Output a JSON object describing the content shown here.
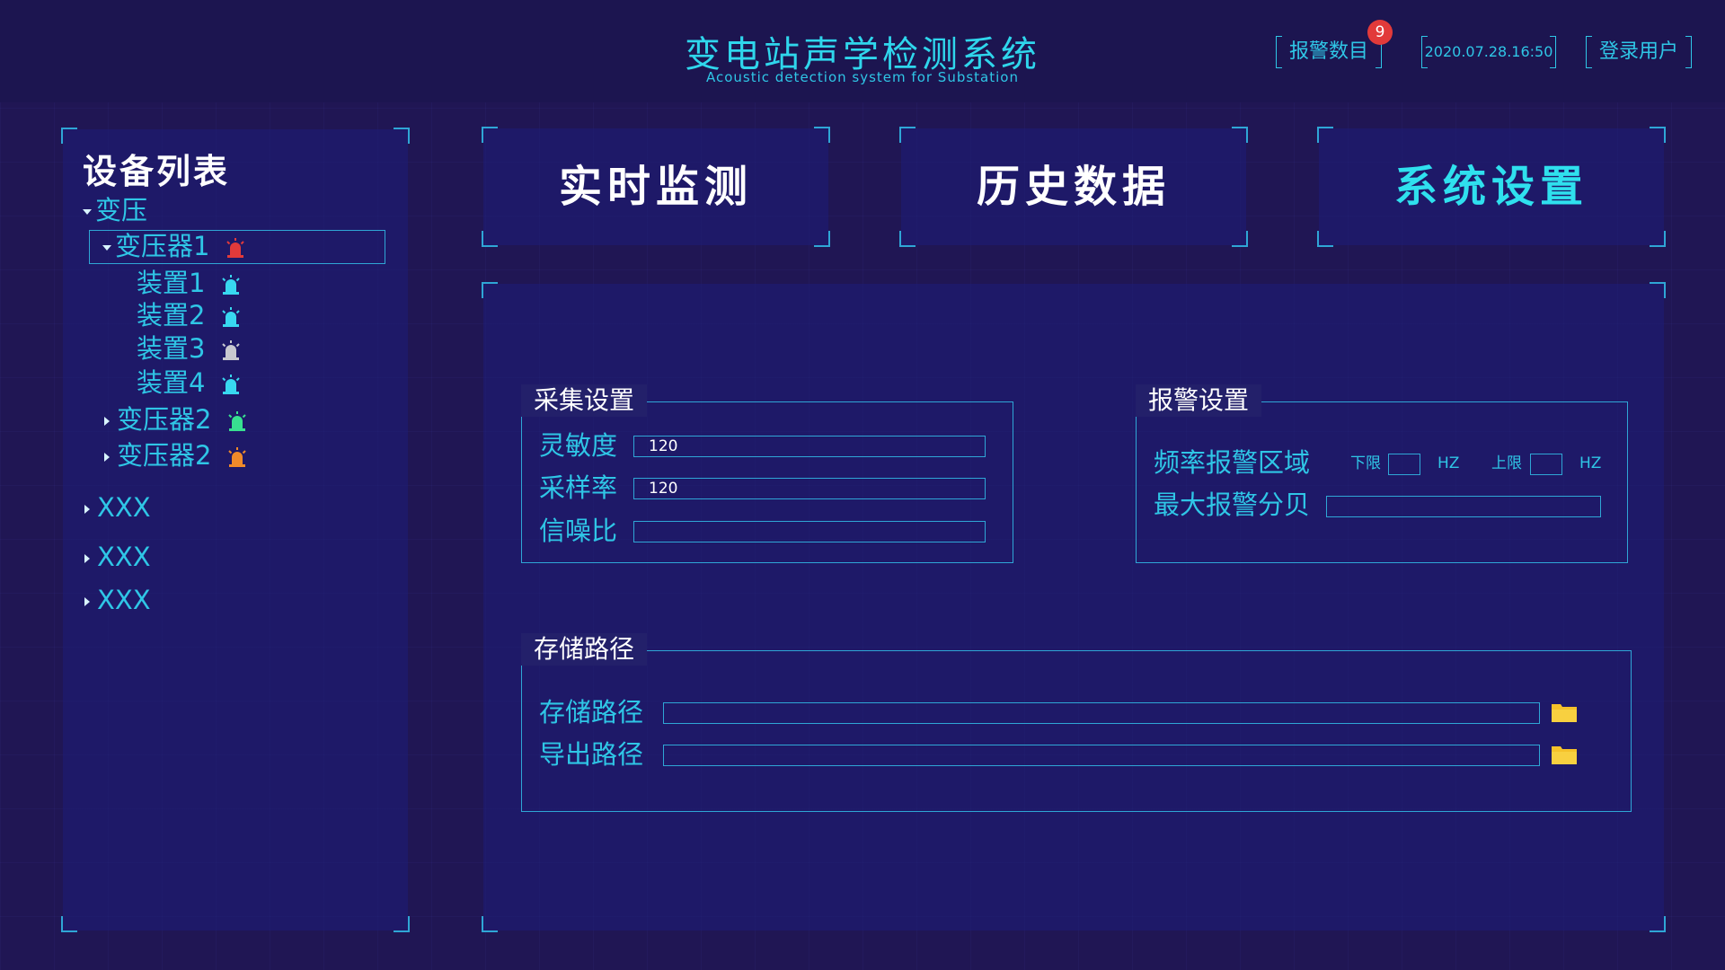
{
  "header": {
    "title_cn": "变电站声学检测系统",
    "title_en": "Acoustic detection system for Substation",
    "alarm_label": "报警数目",
    "alarm_count": "9",
    "datetime": "2020.07.28.16:50",
    "user_label": "登录用户"
  },
  "sidebar": {
    "title": "设备列表",
    "root": "变压",
    "transformer1": "变压器1",
    "devices": [
      "装置1",
      "装置2",
      "装置3",
      "装置4"
    ],
    "transformer2a": "变压器2",
    "transformer2b": "变压器2",
    "others": [
      "XXX",
      "XXX",
      "XXX"
    ]
  },
  "tabs": {
    "realtime": "实时监测",
    "history": "历史数据",
    "settings": "系统设置"
  },
  "collect": {
    "title": "采集设置",
    "sensitivity_label": "灵敏度",
    "sensitivity_value": "120",
    "sample_rate_label": "采样率",
    "sample_rate_value": "120",
    "snr_label": "信噪比",
    "snr_value": ""
  },
  "alarm_settings": {
    "title": "报警设置",
    "freq_label": "频率报警区域",
    "lower_label": "下限",
    "upper_label": "上限",
    "unit": "HZ",
    "max_db_label": "最大报警分贝"
  },
  "storage": {
    "title": "存储路径",
    "store_label": "存储路径",
    "export_label": "导出路径"
  },
  "colors": {
    "accent": "#2fc6e6",
    "alarm_red": "#e23a3a",
    "alarm_orange": "#f08a2a",
    "ok_cyan": "#38d8f0",
    "ok_green": "#38e090",
    "idle_gray": "#c8c8d0",
    "folder": "#f5c22a"
  },
  "icons": [
    "alarm-light-icon",
    "folder-icon",
    "triangle-down-icon",
    "triangle-right-icon"
  ]
}
